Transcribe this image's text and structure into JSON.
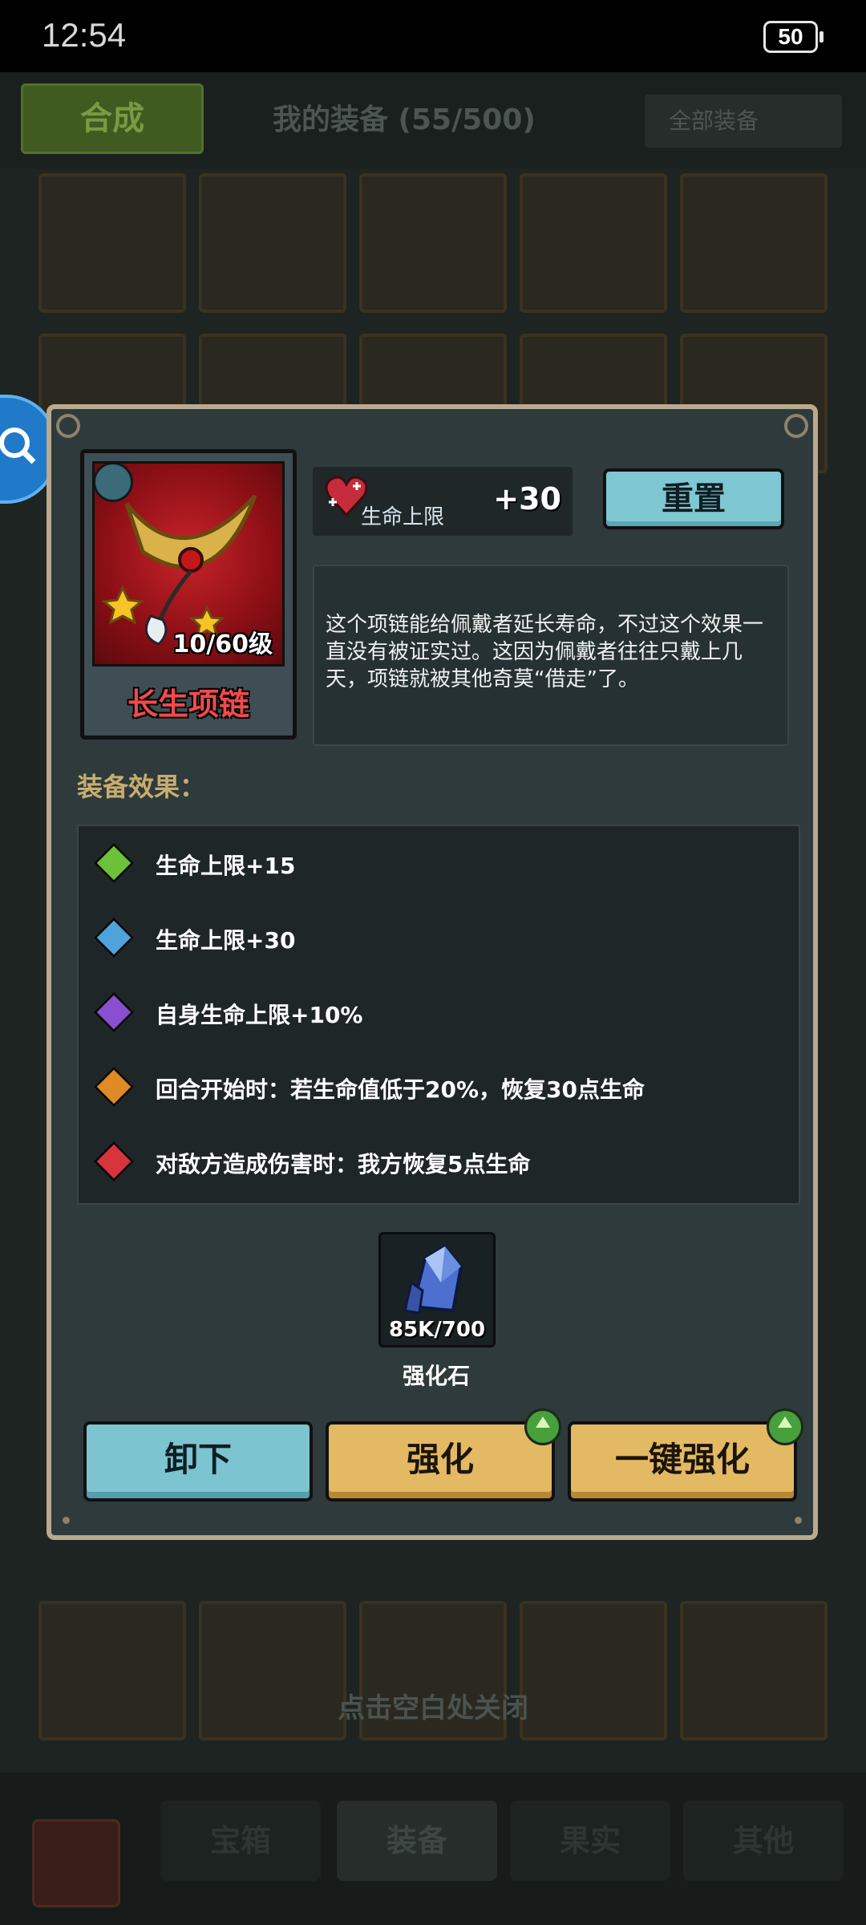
{
  "status_bar": {
    "time": "12:54",
    "battery": "50"
  },
  "background": {
    "synth_tab": "合成",
    "title": "我的装备 (55/500)",
    "filter": "全部装备",
    "nav": [
      "宝箱",
      "装备",
      "果实",
      "其他"
    ],
    "close_hint": "点击空白处关闭"
  },
  "item": {
    "name": "长生项链",
    "level": "10/60级",
    "stat_label": "生命上限",
    "stat_value": "+30",
    "reset_label": "重置",
    "description": "这个项链能给佩戴者延长寿命，不过这个效果一直没有被证实过。这因为佩戴者往往只戴上几天，项链就被其他奇莫“借走”了。"
  },
  "effects": {
    "title": "装备效果：",
    "items": [
      {
        "text": "生命上限+15",
        "color": "#6cc13a"
      },
      {
        "text": "生命上限+30",
        "color": "#4ea3db"
      },
      {
        "text": "自身生命上限+10%",
        "color": "#8a4fd0"
      },
      {
        "text": "回合开始时：若生命值低于20%，恢复30点生命",
        "color": "#e08a25"
      },
      {
        "text": "对敌方造成伤害时：我方恢复5点生命",
        "color": "#d8343c"
      }
    ]
  },
  "material": {
    "count": "85K/700",
    "name": "强化石"
  },
  "buttons": {
    "unequip": "卸下",
    "enhance": "强化",
    "one_click": "一键强化"
  }
}
